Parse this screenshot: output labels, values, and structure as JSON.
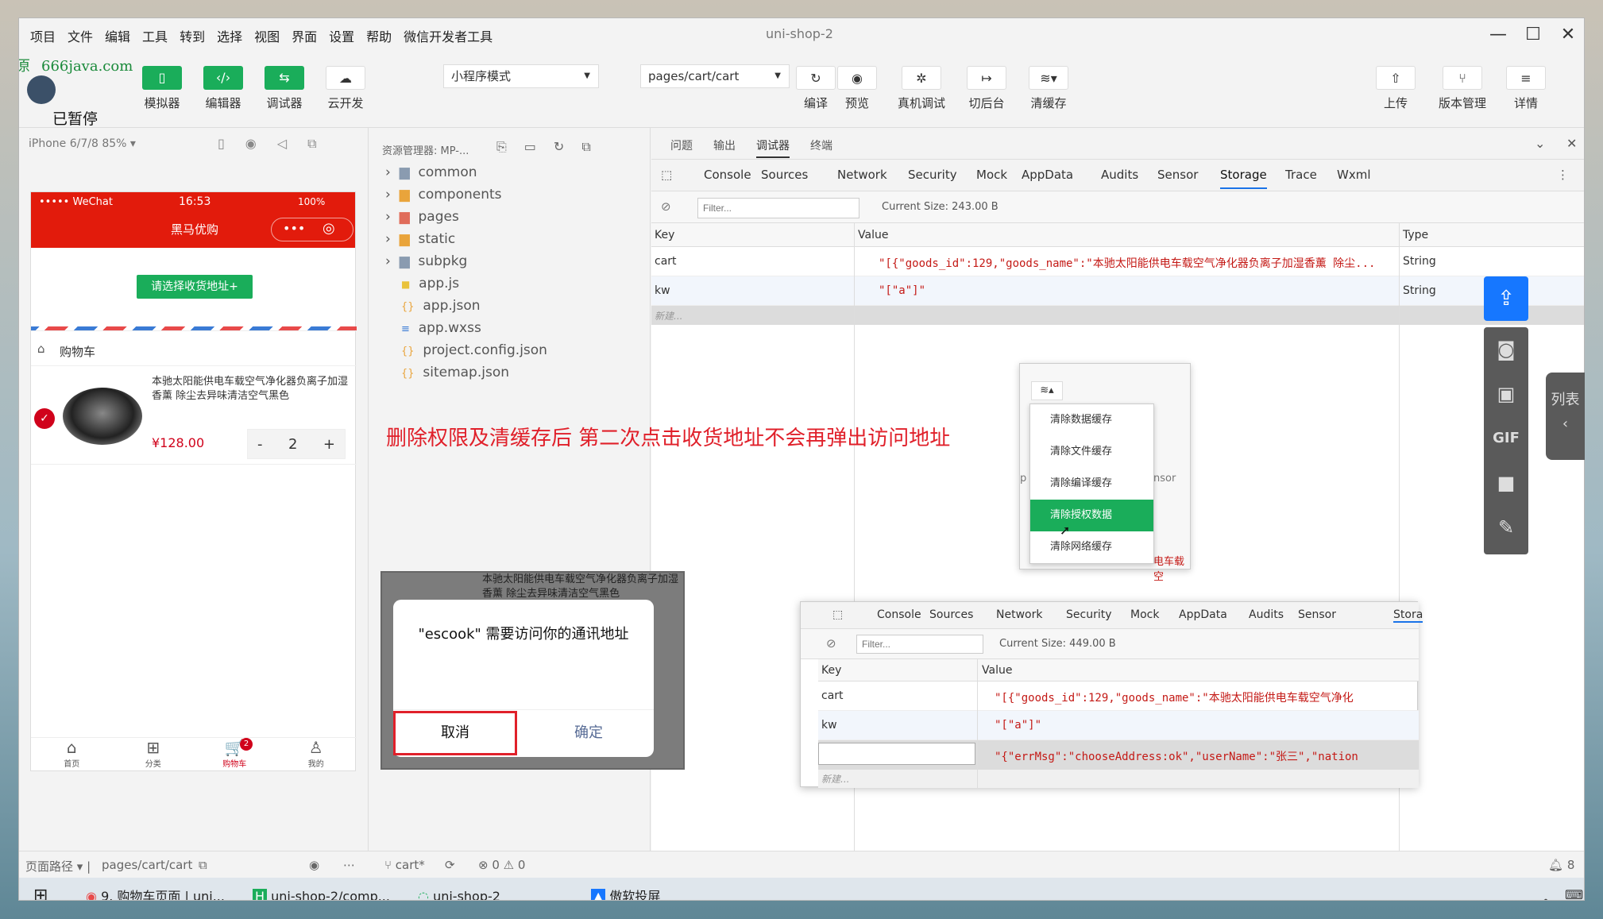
{
  "window": {
    "title": "uni-shop-2",
    "menu": [
      "项目",
      "文件",
      "编辑",
      "工具",
      "转到",
      "选择",
      "视图",
      "界面",
      "设置",
      "帮助",
      "微信开发者工具"
    ]
  },
  "watermark": {
    "site": "666java.com",
    "left_char": "原",
    "status": "已暂停"
  },
  "toolbar": {
    "simulator": "模拟器",
    "editor": "编辑器",
    "debugger": "调试器",
    "cloud": "云开发",
    "mode_select": "小程序模式",
    "page_select": "pages/cart/cart",
    "compile": "编译",
    "preview": "预览",
    "remote_debug": "真机调试",
    "background": "切后台",
    "clear_cache": "清缓存",
    "upload": "上传",
    "version": "版本管理",
    "details": "详情"
  },
  "simulator": {
    "device": "iPhone 6/7/8 85%",
    "status_carrier": "••••• WeChat",
    "status_time": "16:53",
    "status_battery": "100%",
    "nav_title": "黑马优购",
    "address_button": "请选择收货地址+",
    "cart_title": "购物车",
    "product_name": "本驰太阳能供电车载空气净化器负离子加湿香薰 除尘去异味清洁空气黑色",
    "product_price": "¥128.00",
    "qty": "2",
    "minus": "-",
    "plus": "+",
    "tabs": [
      "首页",
      "分类",
      "购物车",
      "我的"
    ],
    "cart_badge": "2"
  },
  "explorer": {
    "title": "资源管理器: MP-...",
    "items": [
      "common",
      "components",
      "pages",
      "static",
      "subpkg",
      "app.js",
      "app.json",
      "app.wxss",
      "project.config.json",
      "sitemap.json"
    ]
  },
  "debugger": {
    "top_tabs": [
      "问题",
      "输出",
      "调试器",
      "终端"
    ],
    "tabs": [
      "Console",
      "Sources",
      "Network",
      "Security",
      "Mock",
      "AppData",
      "Audits",
      "Sensor",
      "Storage",
      "Trace",
      "Wxml"
    ],
    "filter_placeholder": "Filter...",
    "current_size": "Current Size: 243.00 B",
    "col_key": "Key",
    "col_value": "Value",
    "col_type": "Type",
    "rows": [
      {
        "key": "cart",
        "value": "\"[{\"goods_id\":129,\"goods_name\":\"本驰太阳能供电车载空气净化器负离子加湿香薰 除尘...",
        "type": "String"
      },
      {
        "key": "kw",
        "value": "\"[\"a\"]\"",
        "type": "String"
      }
    ],
    "new_row": "新建..."
  },
  "annotation": "删除权限及清缓存后  第二次点击收货地址不会再弹出访问地址",
  "context_menu": {
    "items": [
      "清除数据缓存",
      "清除文件缓存",
      "清除编译缓存",
      "清除授权数据",
      "清除网络缓存"
    ],
    "frag_left": "p",
    "frag_right": "nsor",
    "frag_bottom": "电车载空"
  },
  "dialog": {
    "bg_text": "本驰太阳能供电车载空气净化器负离子加湿香薰 除尘去异味清洁空气黑色",
    "message": "\"escook\" 需要访问你的通讯地址",
    "cancel": "取消",
    "confirm": "确定"
  },
  "storage2": {
    "tabs": [
      "Console",
      "Sources",
      "Network",
      "Security",
      "Mock",
      "AppData",
      "Audits",
      "Sensor",
      "Stora"
    ],
    "filter_placeholder": "Filter...",
    "current_size": "Current Size: 449.00 B",
    "col_key": "Key",
    "col_value": "Value",
    "rows": [
      {
        "key": "cart",
        "value": "\"[{\"goods_id\":129,\"goods_name\":\"本驰太阳能供电车载空气净化"
      },
      {
        "key": "kw",
        "value": "\"[\"a\"]\""
      },
      {
        "key": "",
        "value": "\"{\"errMsg\":\"chooseAddress:ok\",\"userName\":\"张三\",\"nation"
      }
    ],
    "new_row": "新建..."
  },
  "side": {
    "list_label": "列表"
  },
  "statusbar": {
    "path_label": "页面路径",
    "path": "pages/cart/cart",
    "branch": "cart*",
    "errors": "0",
    "warnings": "0",
    "notif": "8"
  },
  "taskbar": {
    "items": [
      "9. 购物车页面 | uni...",
      "uni-shop-2/comp...",
      "uni-shop-2",
      "傲软投屏"
    ]
  },
  "colors": {
    "accent_green": "#1aad5a",
    "wx_red": "#e21b0c",
    "annotation_red": "#e0202a"
  }
}
